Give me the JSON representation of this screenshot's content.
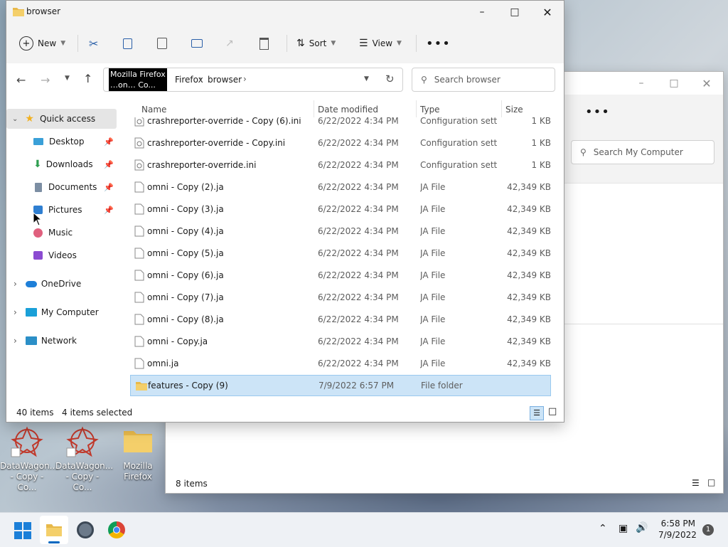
{
  "main_window": {
    "title": "browser",
    "toolbar": {
      "new_label": "New",
      "sort_label": "Sort",
      "view_label": "View"
    },
    "breadcrumb": {
      "root_label": "Firefox",
      "current_label": "browser"
    },
    "search_placeholder": "Search browser",
    "tooltip": {
      "line1": "Mozilla Firefox",
      "line2": "…on… Co..."
    },
    "sidebar": {
      "quick_access": "Quick access",
      "items": [
        {
          "label": "Desktop",
          "icon": "desktop-icon",
          "pinned": true
        },
        {
          "label": "Downloads",
          "icon": "download-icon",
          "pinned": true
        },
        {
          "label": "Documents",
          "icon": "documents-icon",
          "pinned": true
        },
        {
          "label": "Pictures",
          "icon": "pictures-icon",
          "pinned": true
        },
        {
          "label": "Music",
          "icon": "music-icon",
          "pinned": false
        },
        {
          "label": "Videos",
          "icon": "videos-icon",
          "pinned": false
        }
      ],
      "onedrive": "OneDrive",
      "my_computer": "My Computer",
      "network": "Network"
    },
    "columns": {
      "name": "Name",
      "date": "Date modified",
      "type": "Type",
      "size": "Size"
    },
    "files": [
      {
        "name": "crashreporter-override - Copy (6).ini",
        "date": "6/22/2022 4:34 PM",
        "type": "Configuration sett...",
        "size": "1 KB",
        "icon": "ini-file-icon"
      },
      {
        "name": "crashreporter-override - Copy.ini",
        "date": "6/22/2022 4:34 PM",
        "type": "Configuration sett...",
        "size": "1 KB",
        "icon": "ini-file-icon"
      },
      {
        "name": "crashreporter-override.ini",
        "date": "6/22/2022 4:34 PM",
        "type": "Configuration sett...",
        "size": "1 KB",
        "icon": "ini-file-icon"
      },
      {
        "name": "omni - Copy (2).ja",
        "date": "6/22/2022 4:34 PM",
        "type": "JA File",
        "size": "42,349 KB",
        "icon": "file-icon"
      },
      {
        "name": "omni - Copy (3).ja",
        "date": "6/22/2022 4:34 PM",
        "type": "JA File",
        "size": "42,349 KB",
        "icon": "file-icon"
      },
      {
        "name": "omni - Copy (4).ja",
        "date": "6/22/2022 4:34 PM",
        "type": "JA File",
        "size": "42,349 KB",
        "icon": "file-icon"
      },
      {
        "name": "omni - Copy (5).ja",
        "date": "6/22/2022 4:34 PM",
        "type": "JA File",
        "size": "42,349 KB",
        "icon": "file-icon"
      },
      {
        "name": "omni - Copy (6).ja",
        "date": "6/22/2022 4:34 PM",
        "type": "JA File",
        "size": "42,349 KB",
        "icon": "file-icon"
      },
      {
        "name": "omni - Copy (7).ja",
        "date": "6/22/2022 4:34 PM",
        "type": "JA File",
        "size": "42,349 KB",
        "icon": "file-icon"
      },
      {
        "name": "omni - Copy (8).ja",
        "date": "6/22/2022 4:34 PM",
        "type": "JA File",
        "size": "42,349 KB",
        "icon": "file-icon"
      },
      {
        "name": "omni - Copy.ja",
        "date": "6/22/2022 4:34 PM",
        "type": "JA File",
        "size": "42,349 KB",
        "icon": "file-icon"
      },
      {
        "name": "omni.ja",
        "date": "6/22/2022 4:34 PM",
        "type": "JA File",
        "size": "42,349 KB",
        "icon": "file-icon"
      },
      {
        "name": "features - Copy (9)",
        "date": "7/9/2022 6:57 PM",
        "type": "File folder",
        "size": "",
        "icon": "folder-icon",
        "selected": true
      }
    ],
    "status": {
      "count": "40 items",
      "selected": "4 items selected"
    }
  },
  "back_window": {
    "search_placeholder": "Search My Computer",
    "status": "8 items"
  },
  "desktop_icons": [
    {
      "label1": "DataWagon...",
      "label2": "- Copy - Co...",
      "icon": "datawagon-shortcut-icon"
    },
    {
      "label1": "DataWagon...",
      "label2": "- Copy - Co...",
      "icon": "datawagon-shortcut-icon"
    },
    {
      "label1": "Mozilla",
      "label2": "Firefox",
      "icon": "folder-icon"
    }
  ],
  "taskbar": {
    "time": "6:58 PM",
    "date": "7/9/2022",
    "notification_count": "1"
  },
  "colors": {
    "selection": "#cce4f7",
    "accent": "#0067c0",
    "folder": "#f4c542"
  }
}
